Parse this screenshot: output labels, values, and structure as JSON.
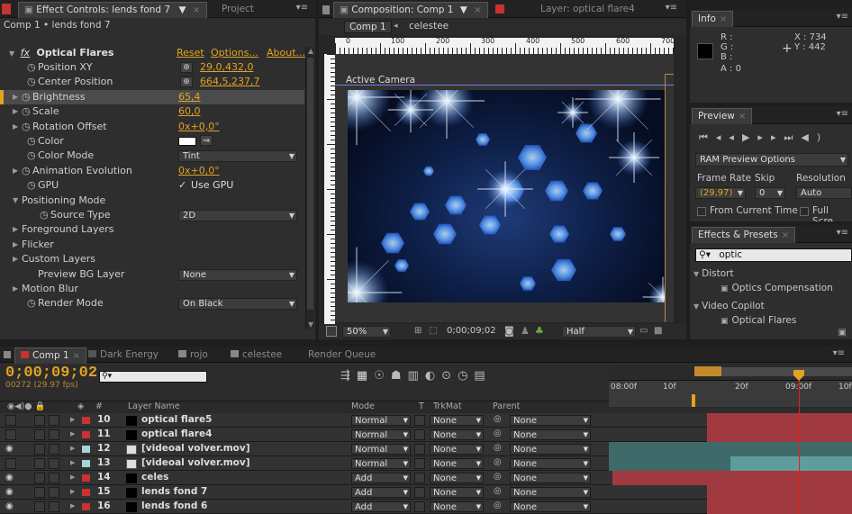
{
  "effect_controls": {
    "tab_label": "Effect Controls: lends fond 7",
    "project_tab": "Project",
    "breadcrumb": "Comp 1 • lends fond 7",
    "effect_name": "Optical Flares",
    "links": {
      "reset": "Reset",
      "options": "Options...",
      "about": "About..."
    },
    "props": [
      {
        "label": "Position XY",
        "value": "29,0,432,0"
      },
      {
        "label": "Center Position",
        "value": "664,5,237,7"
      },
      {
        "label": "Brightness",
        "value": "65,4"
      },
      {
        "label": "Scale",
        "value": "60,0"
      },
      {
        "label": "Rotation Offset",
        "value": "0x+0,0°"
      },
      {
        "label": "Color",
        "value": ""
      },
      {
        "label": "Color Mode",
        "value": "Tint"
      },
      {
        "label": "Animation Evolution",
        "value": "0x+0,0°"
      },
      {
        "label": "GPU",
        "value": "Use GPU"
      },
      {
        "label": "Positioning Mode",
        "value": ""
      },
      {
        "label": "Source Type",
        "value": "2D"
      },
      {
        "label": "Foreground Layers",
        "value": ""
      },
      {
        "label": "Flicker",
        "value": ""
      },
      {
        "label": "Custom Layers",
        "value": ""
      },
      {
        "label": "Preview BG Layer",
        "value": "None"
      },
      {
        "label": "Motion Blur",
        "value": ""
      },
      {
        "label": "Render Mode",
        "value": "On Black"
      }
    ]
  },
  "composition": {
    "tab_label": "Composition: Comp 1",
    "layer_tab": "Layer: optical flare4",
    "comp_btn": "Comp 1",
    "crumb": "celestee",
    "ruler_ticks": [
      "0",
      "100",
      "200",
      "300",
      "400",
      "500",
      "600",
      "700"
    ],
    "camera_label": "Active Camera",
    "zoom": "50%",
    "timecode": "0;00;09;02",
    "resolution": "Half"
  },
  "info": {
    "tab_label": "Info",
    "r": "R :",
    "g": "G :",
    "b": "B :",
    "a": "A : 0",
    "x": "X : 734",
    "y": "Y : 442"
  },
  "preview": {
    "tab_label": "Preview",
    "ram_options": "RAM Preview Options",
    "frame_rate_label": "Frame Rate",
    "skip_label": "Skip",
    "resolution_label": "Resolution",
    "frame_rate": "(29,97)",
    "skip": "0",
    "resolution": "Auto",
    "from_current": "From Current Time",
    "full_screen": "Full Scre"
  },
  "effects_presets": {
    "tab_label": "Effects & Presets",
    "search": "optic",
    "groups": [
      {
        "label": "Distort",
        "item": "Optics Compensation"
      },
      {
        "label": "Video Copilot",
        "item": "Optical Flares"
      }
    ]
  },
  "timeline": {
    "tabs": [
      "Comp 1",
      "Dark Energy",
      "rojo",
      "celestee",
      "Render Queue"
    ],
    "timecode": "0;00;09;02",
    "frames": "00272 (29.97 fps)",
    "ruler": [
      "08:00f",
      "10f",
      "20f",
      "09:00f",
      "10f"
    ],
    "headers": {
      "num": "#",
      "layer_name": "Layer Name",
      "mode": "Mode",
      "t": "T",
      "trkmat": "TrkMat",
      "parent": "Parent"
    },
    "layers": [
      {
        "num": "10",
        "name": "optical flare5",
        "mode": "Normal",
        "trkmat": "None",
        "parent": "None",
        "color": "#c83232",
        "thumb": "solid",
        "eye": false
      },
      {
        "num": "11",
        "name": "optical flare4",
        "mode": "Normal",
        "trkmat": "None",
        "parent": "None",
        "color": "#c83232",
        "thumb": "solid",
        "eye": false
      },
      {
        "num": "12",
        "name": "[videoal volver.mov]",
        "mode": "Normal",
        "trkmat": "None",
        "parent": "None",
        "color": "#a7d4d4",
        "thumb": "footage",
        "eye": true
      },
      {
        "num": "13",
        "name": "[videoal volver.mov]",
        "mode": "Normal",
        "trkmat": "None",
        "parent": "None",
        "color": "#a7d4d4",
        "thumb": "footage",
        "eye": false
      },
      {
        "num": "14",
        "name": "celes",
        "mode": "Add",
        "trkmat": "None",
        "parent": "None",
        "color": "#c83232",
        "thumb": "solid",
        "eye": true
      },
      {
        "num": "15",
        "name": "lends fond 7",
        "mode": "Add",
        "trkmat": "None",
        "parent": "None",
        "color": "#c83232",
        "thumb": "solid",
        "eye": true
      },
      {
        "num": "16",
        "name": "lends fond 6",
        "mode": "Add",
        "trkmat": "None",
        "parent": "None",
        "color": "#c83232",
        "thumb": "solid",
        "eye": true
      }
    ]
  },
  "colors": {
    "accent": "#e3a321",
    "layer_red": "#a03a40",
    "layer_teal": "#5f9c9c",
    "playhead": "#e02020"
  }
}
